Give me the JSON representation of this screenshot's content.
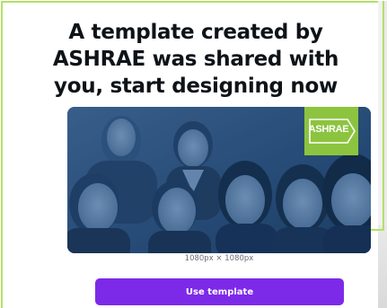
{
  "dialog": {
    "headline": "A template created by ASHRAE was shared with you, start designing now",
    "image": {
      "alt": "Photo of a smiling group of professionals with blue duotone overlay",
      "logo_text": "ASHRAE"
    },
    "dimensions": "1080px × 1080px",
    "use_template_label": "Use template"
  },
  "colors": {
    "accent_border": "#b3e066",
    "button_purple": "#7d2ae8",
    "image_blue": "#2b4c72",
    "logo_green": "#8cc43f"
  }
}
